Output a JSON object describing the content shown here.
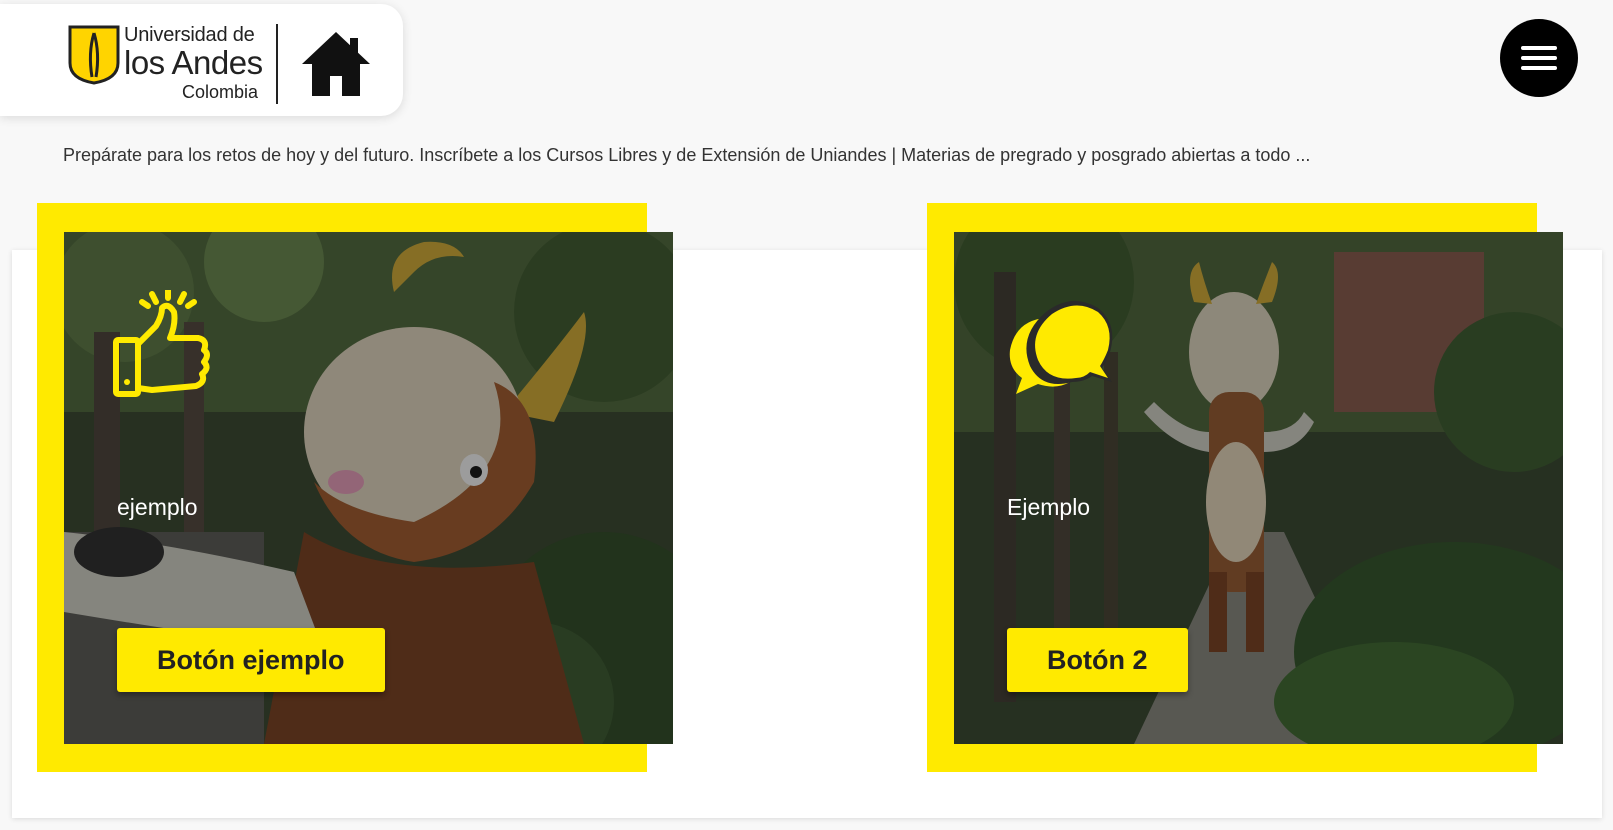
{
  "header": {
    "logo": {
      "line1": "Universidad de",
      "line2": "los Andes",
      "line3": "Colombia"
    },
    "home_icon": "home-icon",
    "menu_icon": "hamburger-menu-icon"
  },
  "tagline": "Prepárate para los retos de hoy y del futuro. Inscríbete a los Cursos Libres y de Extensión de Uniandes | Materias de pregrado y posgrado abiertas a todo ...",
  "cards": [
    {
      "icon": "thumbs-up-icon",
      "text": "ejemplo",
      "button_label": "Botón ejemplo"
    },
    {
      "icon": "chat-bubbles-icon",
      "text": "Ejemplo",
      "button_label": "Botón 2"
    }
  ],
  "colors": {
    "accent_yellow": "#ffea00",
    "menu_black": "#000000",
    "background": "#f8f8f8",
    "panel": "#ffffff"
  }
}
